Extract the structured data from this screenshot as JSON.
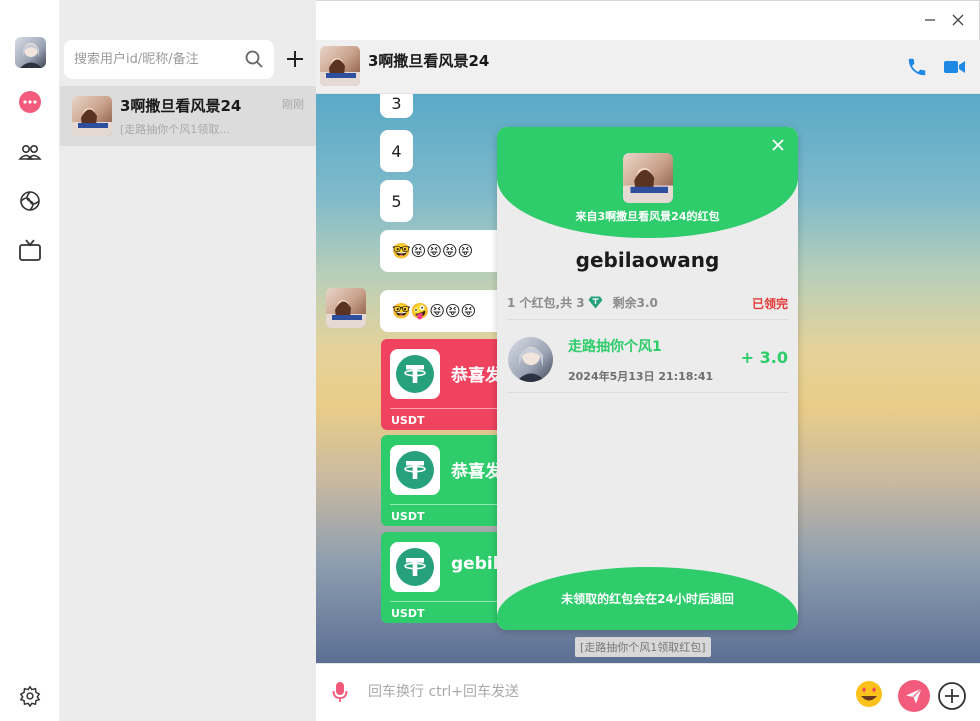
{
  "search": {
    "placeholder": "搜索用户id/昵称/备注"
  },
  "conversations": [
    {
      "name": "3啊撒旦看风景24",
      "time": "刚刚",
      "preview": "[走路抽你个风1领取..."
    }
  ],
  "chat": {
    "title": "3啊撒旦看风景24",
    "messages": {
      "n3": "3",
      "n4": "4",
      "n5": "5",
      "emoji_row_1": "🤓😝😝😝😝",
      "emoji_row_2": "🤓🤪😝😝😝"
    },
    "packets": [
      {
        "text": "恭喜发",
        "label": "USDT",
        "color": "#f0435f"
      },
      {
        "text": "恭喜发",
        "label": "USDT",
        "color": "#2ecc6b"
      },
      {
        "text": "gebila",
        "label": "USDT",
        "color": "#2ecc6b"
      }
    ],
    "system_note": "[走路抽你个风1领取红包]"
  },
  "popup": {
    "from_text": "来自3啊撒旦看风景24的红包",
    "sender_name": "gebilaowang",
    "summary_prefix": "1 个红包,共 3",
    "summary_remaining": "剩余3.0",
    "status": "已领完",
    "receiver": {
      "name": "走路抽你个风1",
      "time": "2024年5月13日 21:18:41",
      "amount": "+ 3.0"
    },
    "footer_note": "未领取的红包会在24小时后退回"
  },
  "input": {
    "placeholder": "回车换行 ctrl+回车发送"
  },
  "colors": {
    "accent_green": "#2ecc6b",
    "accent_red": "#f0435f",
    "call_blue": "#1e88e5",
    "send_pink": "#f25b7c"
  }
}
